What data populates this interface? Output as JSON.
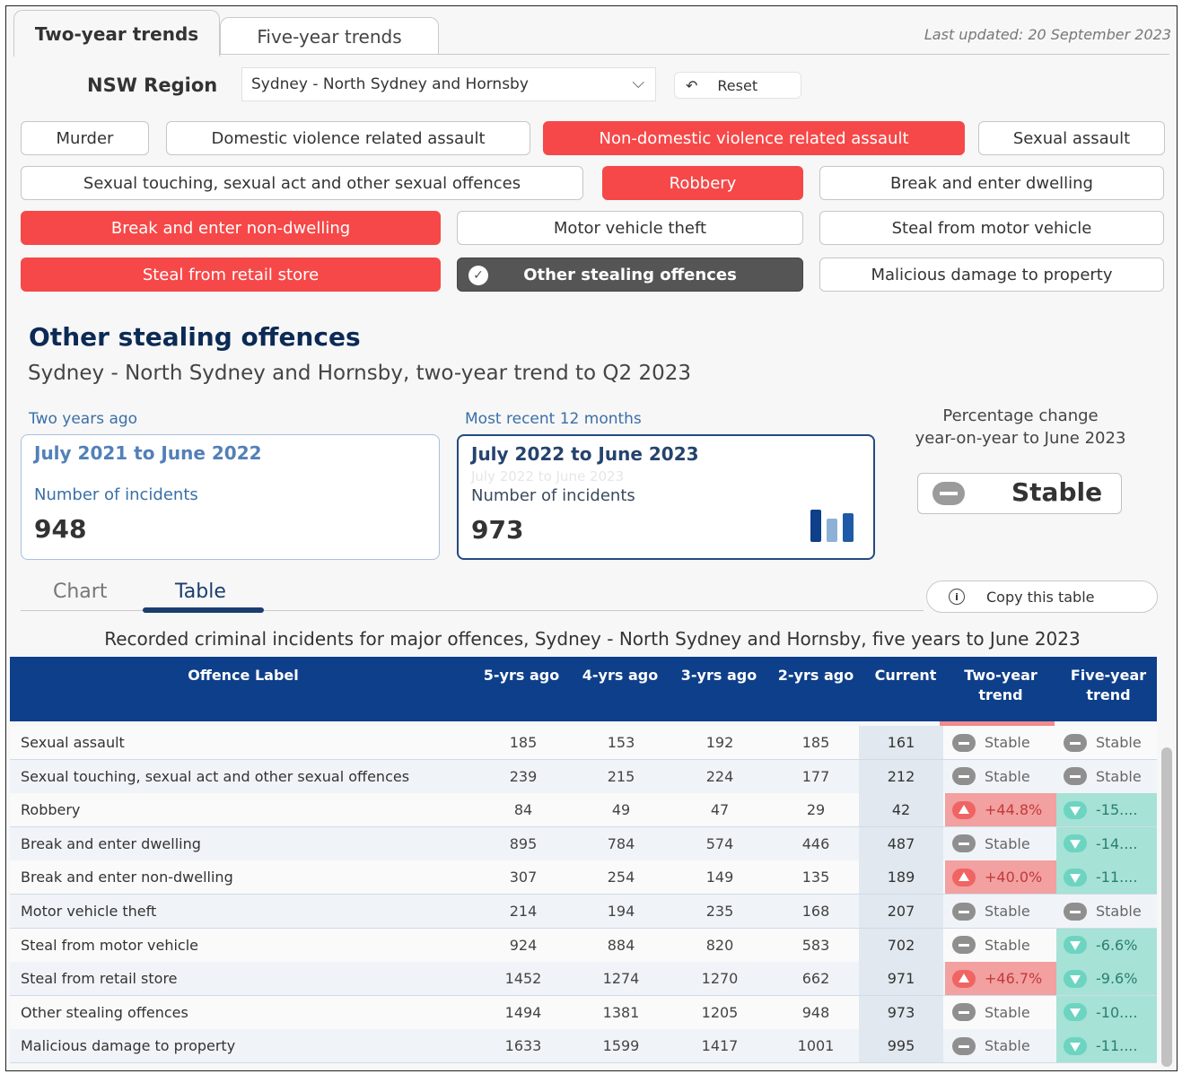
{
  "tabs": {
    "two_year": "Two-year trends",
    "five_year": "Five-year trends"
  },
  "last_updated": "Last updated: 20 September 2023",
  "region": {
    "label": "NSW Region",
    "selected": "Sydney - North Sydney and Hornsby",
    "reset_label": "Reset"
  },
  "offence_chips": [
    {
      "label": "Murder",
      "state": "unselected"
    },
    {
      "label": "Domestic violence related assault",
      "state": "unselected"
    },
    {
      "label": "Non-domestic violence related assault",
      "state": "selected"
    },
    {
      "label": "Sexual assault",
      "state": "unselected"
    },
    {
      "label": "Sexual touching, sexual act and other sexual offences",
      "state": "unselected"
    },
    {
      "label": "Robbery",
      "state": "selected"
    },
    {
      "label": "Break and enter dwelling",
      "state": "unselected"
    },
    {
      "label": "Break and enter non-dwelling",
      "state": "selected"
    },
    {
      "label": "Motor vehicle theft",
      "state": "unselected"
    },
    {
      "label": "Steal from motor vehicle",
      "state": "unselected"
    },
    {
      "label": "Steal from retail store",
      "state": "selected"
    },
    {
      "label": "Other stealing offences",
      "state": "active"
    },
    {
      "label": "Malicious damage to property",
      "state": "unselected"
    }
  ],
  "summary": {
    "title": "Other stealing offences",
    "subtitle": "Sydney - North Sydney and Hornsby, two-year trend to Q2 2023",
    "previous": {
      "caption": "Two years ago",
      "period": "July 2021 to June 2022",
      "label": "Number of incidents",
      "value": "948"
    },
    "current": {
      "caption": "Most recent 12 months",
      "period": "July 2022 to June 2023",
      "ghost": "July 2022 to June 2023",
      "label": "Number of incidents",
      "value": "973"
    },
    "pct_change_line1": "Percentage change",
    "pct_change_line2": "year-on-year to June 2023",
    "trend": "Stable"
  },
  "view_tabs": {
    "chart": "Chart",
    "table": "Table"
  },
  "copy_label": "Copy this table",
  "table": {
    "caption": "Recorded criminal incidents for major offences, Sydney - North Sydney and Hornsby, five years to June 2023",
    "headers": [
      "Offence Label",
      "5-yrs ago",
      "4-yrs ago",
      "3-yrs ago",
      "2-yrs ago",
      "Current",
      "Two-year trend",
      "Five-year trend"
    ],
    "rows": [
      {
        "label": "Sexual assault",
        "v5": "185",
        "v4": "153",
        "v3": "192",
        "v2": "185",
        "cur": "161",
        "two": "Stable",
        "two_dir": "stable",
        "five": "Stable",
        "five_dir": "stable"
      },
      {
        "label": "Sexual touching, sexual act and other sexual offences",
        "v5": "239",
        "v4": "215",
        "v3": "224",
        "v2": "177",
        "cur": "212",
        "two": "Stable",
        "two_dir": "stable",
        "five": "Stable",
        "five_dir": "stable"
      },
      {
        "label": "Robbery",
        "v5": "84",
        "v4": "49",
        "v3": "47",
        "v2": "29",
        "cur": "42",
        "two": "+44.8%",
        "two_dir": "up",
        "five": "-15....",
        "five_dir": "down"
      },
      {
        "label": "Break and enter dwelling",
        "v5": "895",
        "v4": "784",
        "v3": "574",
        "v2": "446",
        "cur": "487",
        "two": "Stable",
        "two_dir": "stable",
        "five": "-14....",
        "five_dir": "down"
      },
      {
        "label": "Break and enter non-dwelling",
        "v5": "307",
        "v4": "254",
        "v3": "149",
        "v2": "135",
        "cur": "189",
        "two": "+40.0%",
        "two_dir": "up",
        "five": "-11....",
        "five_dir": "down"
      },
      {
        "label": "Motor vehicle theft",
        "v5": "214",
        "v4": "194",
        "v3": "235",
        "v2": "168",
        "cur": "207",
        "two": "Stable",
        "two_dir": "stable",
        "five": "Stable",
        "five_dir": "stable"
      },
      {
        "label": "Steal from motor vehicle",
        "v5": "924",
        "v4": "884",
        "v3": "820",
        "v2": "583",
        "cur": "702",
        "two": "Stable",
        "two_dir": "stable",
        "five": "-6.6%",
        "five_dir": "down"
      },
      {
        "label": "Steal from retail store",
        "v5": "1452",
        "v4": "1274",
        "v3": "1270",
        "v2": "662",
        "cur": "971",
        "two": "+46.7%",
        "two_dir": "up",
        "five": "-9.6%",
        "five_dir": "down"
      },
      {
        "label": "Other stealing offences",
        "v5": "1494",
        "v4": "1381",
        "v3": "1205",
        "v2": "948",
        "cur": "973",
        "two": "Stable",
        "two_dir": "stable",
        "five": "-10....",
        "five_dir": "down"
      },
      {
        "label": "Malicious damage to property",
        "v5": "1633",
        "v4": "1599",
        "v3": "1417",
        "v2": "1001",
        "cur": "995",
        "two": "Stable",
        "two_dir": "stable",
        "five": "-11....",
        "five_dir": "down"
      }
    ]
  },
  "colors": {
    "selected": "#f64848",
    "active": "#555555",
    "header": "#0e3f8a",
    "accent": "#1c3e6e"
  }
}
